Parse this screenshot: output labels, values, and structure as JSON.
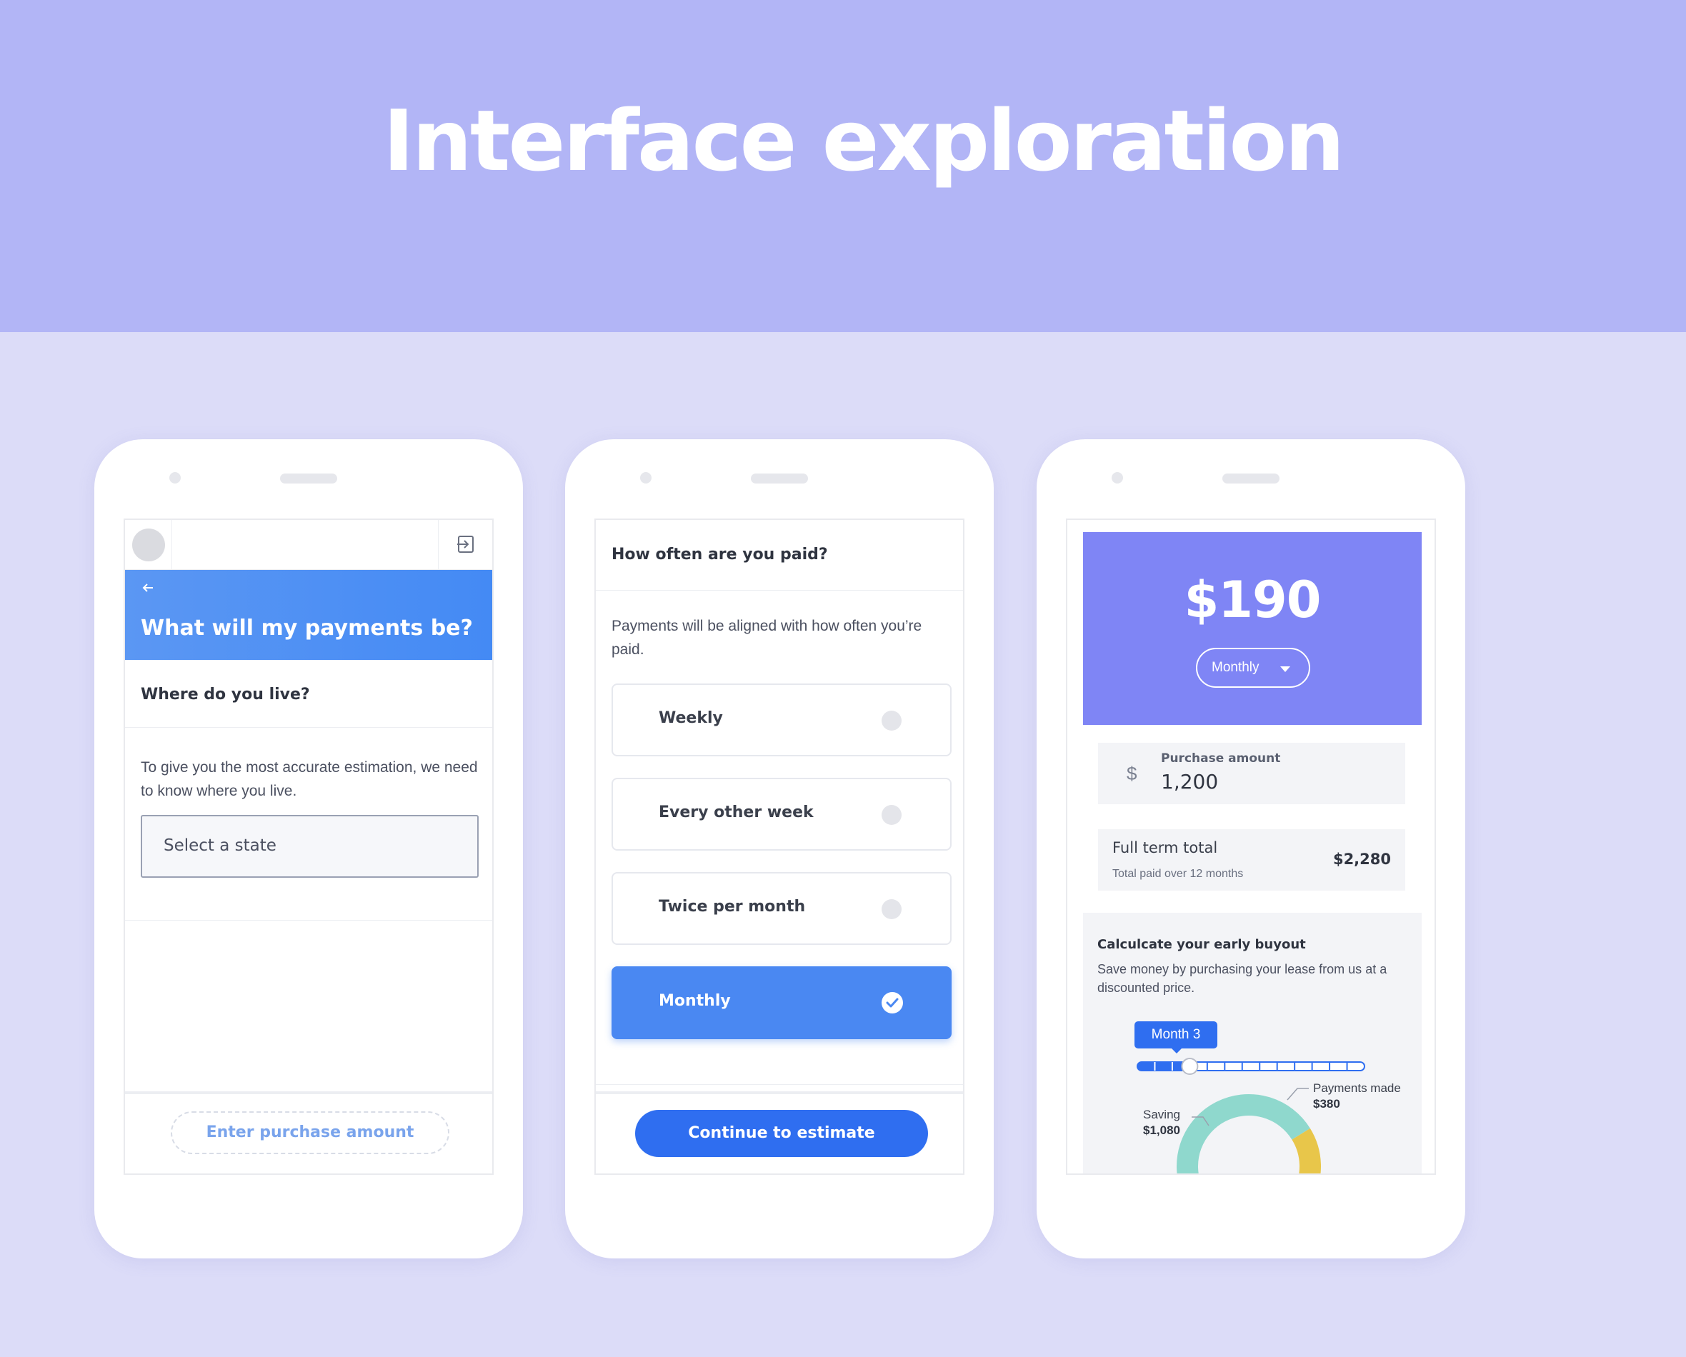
{
  "page": {
    "title": "Interface exploration"
  },
  "colors": {
    "banner": "#b2b5f6",
    "background": "#dcdcf8",
    "primary": "#2f6ef0",
    "hero_blue": "#4a88f2",
    "hero_purple": "#7f85f5"
  },
  "screen1": {
    "title": "What will my payments be?",
    "question": "Where do you live?",
    "description": "To give you the most accurate estimation, we need to know where you live.",
    "select_placeholder": "Select a state",
    "cta": "Enter purchase amount",
    "icons": [
      "avatar",
      "exit-icon",
      "back-arrow-icon"
    ]
  },
  "screen2": {
    "question": "How often are you paid?",
    "description": "Payments will be aligned with how often you’re paid.",
    "options": [
      {
        "label": "Weekly",
        "selected": false
      },
      {
        "label": "Every other week",
        "selected": false
      },
      {
        "label": "Twice per month",
        "selected": false
      },
      {
        "label": "Monthly",
        "selected": true
      }
    ],
    "cta": "Continue to estimate"
  },
  "screen3": {
    "amount": "$190",
    "frequency": "Monthly",
    "purchase_label": "Purchase amount",
    "currency_symbol": "$",
    "purchase_value": "1,200",
    "total_label": "Full term total",
    "total_sub": "Total paid over 12 months",
    "total_value": "$2,280",
    "buyout_title": "Calculcate your early buyout",
    "buyout_desc": "Save money by purchasing your lease from us at a discounted price.",
    "month_tip": "Month 3",
    "slider": {
      "current": 3,
      "max": 12
    },
    "saving_label": "Saving",
    "saving_value": "$1,080",
    "payments_label": "Payments made",
    "payments_value": "$380",
    "donut_colors": {
      "saving": "#8fd8cd",
      "payments": "#e8c64a",
      "remaining": "#2f6ef0"
    }
  }
}
